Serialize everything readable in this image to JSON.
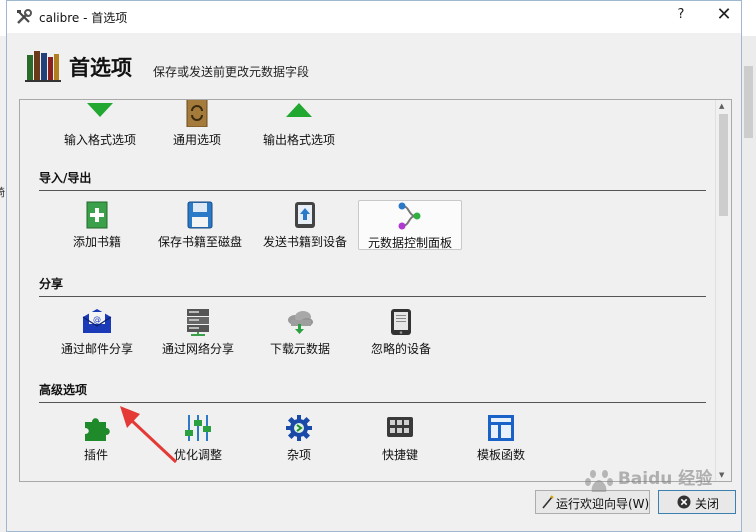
{
  "window": {
    "title": "calibre - 首选项",
    "help_label": "?",
    "close_label": "✕"
  },
  "header": {
    "title": "首选项",
    "subtitle": "保存或发送前更改元数据字段"
  },
  "top_row": [
    {
      "label": "输入格式选项",
      "icon": "arrow-down-green-icon"
    },
    {
      "label": "通用选项",
      "icon": "book-refresh-icon"
    },
    {
      "label": "输出格式选项",
      "icon": "arrow-up-green-icon"
    }
  ],
  "sections": [
    {
      "title": "导入/导出",
      "items": [
        {
          "label": "添加书籍",
          "icon": "add-book-icon"
        },
        {
          "label": "保存书籍至磁盘",
          "icon": "floppy-disk-icon"
        },
        {
          "label": "发送书籍到设备",
          "icon": "send-to-device-icon"
        },
        {
          "label": "元数据控制面板",
          "icon": "metadata-plugboard-icon",
          "selected": true
        }
      ]
    },
    {
      "title": "分享",
      "items": [
        {
          "label": "通过邮件分享",
          "icon": "mail-icon"
        },
        {
          "label": "通过网络分享",
          "icon": "server-icon"
        },
        {
          "label": "下载元数据",
          "icon": "cloud-download-icon"
        },
        {
          "label": "忽略的设备",
          "icon": "tablet-device-icon"
        }
      ]
    },
    {
      "title": "高级选项",
      "items": [
        {
          "label": "插件",
          "icon": "puzzle-icon"
        },
        {
          "label": "优化调整",
          "icon": "sliders-icon"
        },
        {
          "label": "杂项",
          "icon": "gear-icon"
        },
        {
          "label": "快捷键",
          "icon": "keyboard-icon"
        },
        {
          "label": "模板函数",
          "icon": "template-icon"
        }
      ]
    }
  ],
  "buttons": {
    "wizard": "运行欢迎向导(W)",
    "close": "关闭"
  },
  "watermark": {
    "text": "Baidu 经验"
  },
  "left_edge_text": "碕",
  "colors": {
    "accent": "#3c7fb1",
    "annotation_arrow": "#e53935"
  }
}
